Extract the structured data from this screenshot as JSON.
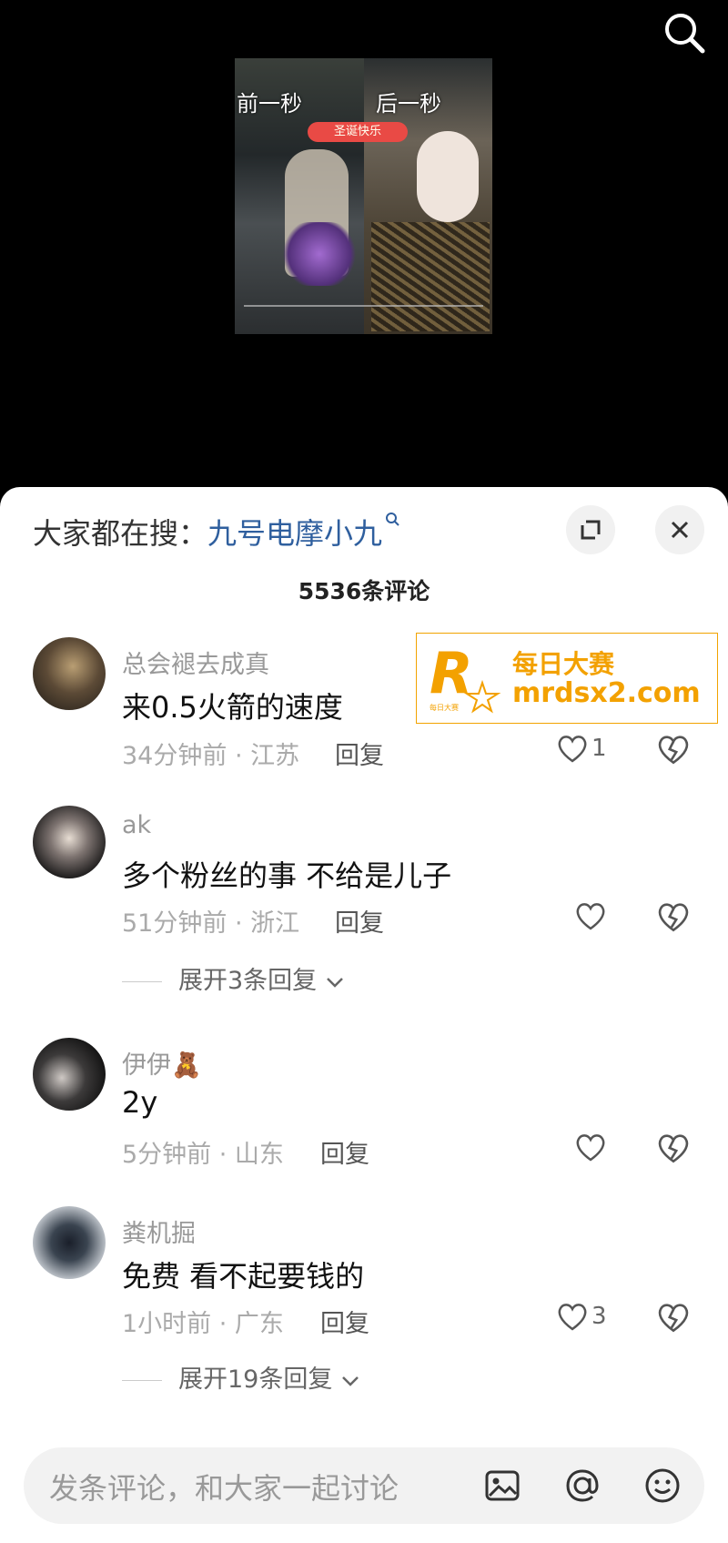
{
  "video": {
    "left_caption": "前一秒",
    "right_caption": "后一秒",
    "badge_text": "圣诞快乐"
  },
  "search": {
    "prefix": "大家都在搜：",
    "term": "九号电摩小九"
  },
  "comments_count": "5536条评论",
  "ad": {
    "line1": "每日大赛",
    "line2": "mrdsx2.com",
    "logo_letter": "R",
    "logo_small": "每日大赛"
  },
  "comments": [
    {
      "user": "总会褪去成真",
      "text": "来0.5火箭的速度",
      "meta": "34分钟前 · 江苏",
      "reply": "回复",
      "likes": "1"
    },
    {
      "user": "ak",
      "text": "多个粉丝的事 不给是儿子",
      "meta": "51分钟前 · 浙江",
      "reply": "回复",
      "likes": "",
      "expand": "展开3条回复"
    },
    {
      "user": "伊伊🧸",
      "text": "2y",
      "meta": "5分钟前 · 山东",
      "reply": "回复",
      "likes": ""
    },
    {
      "user": "粪机掘",
      "text": "免费 看不起要钱的",
      "meta": "1小时前 · 广东",
      "reply": "回复",
      "likes": "3",
      "expand": "展开19条回复"
    }
  ],
  "input": {
    "placeholder": "发条评论，和大家一起讨论"
  },
  "icons": [
    "search-icon",
    "expand-icon",
    "close-icon",
    "heart-icon",
    "dislike-icon",
    "image-icon",
    "at-icon",
    "emoji-icon",
    "chevron-down-icon"
  ]
}
